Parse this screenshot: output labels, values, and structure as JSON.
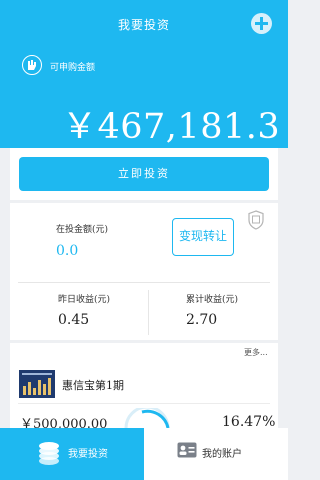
{
  "header": {
    "title": "我要投资",
    "add_icon": "plus-icon",
    "available_label": "可申购金额",
    "available_amount": "￥467,181.3",
    "invest_button": "立即投资"
  },
  "summary": {
    "invested_label": "在投金额(元)",
    "invested_value": "0.0",
    "transfer_button": "变现转让",
    "yesterday_label": "昨日收益(元)",
    "yesterday_value": "0.45",
    "cumulative_label": "累计收益(元)",
    "cumulative_value": "2.70"
  },
  "product": {
    "more_label": "更多...",
    "name": "惠信宝第1期",
    "amount": "￥500,000.00",
    "rate": "16.47%"
  },
  "tabbar": {
    "tabs": [
      {
        "label": "我要投资",
        "icon": "coins-icon",
        "active": true
      },
      {
        "label": "我的账户",
        "icon": "id-card-icon",
        "active": false
      }
    ]
  },
  "colors": {
    "accent": "#1eb8f0",
    "background": "#eef0f3"
  }
}
